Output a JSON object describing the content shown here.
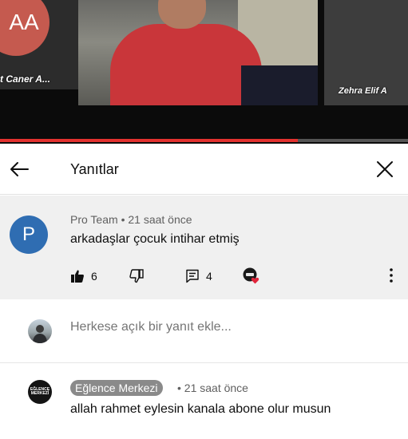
{
  "video": {
    "left_tile_initials": "AA",
    "left_tile_name": "t Caner A...",
    "right_tile_name": "Zehra Elif A",
    "progress": 0.73
  },
  "header": {
    "title": "Yanıtlar"
  },
  "parent_comment": {
    "avatar_letter": "P",
    "author": "Pro Team",
    "separator": "•",
    "time": "21 saat önce",
    "text": "arkadaşlar çocuk intihar etmiş",
    "likes": "6",
    "replies": "4"
  },
  "reply_box": {
    "placeholder": "Herkese açık bir yanıt ekle..."
  },
  "reply": {
    "avatar_text": "EĞLENCE MERKEZİ",
    "author": "Eğlence Merkezi",
    "separator": "•",
    "time": "21 saat önce",
    "text": "allah rahmet eylesin kanala abone olur musun"
  },
  "colors": {
    "accent_red": "#e3322f",
    "parent_avatar": "#2f6db2",
    "author_chip": "#8a8a8a"
  }
}
